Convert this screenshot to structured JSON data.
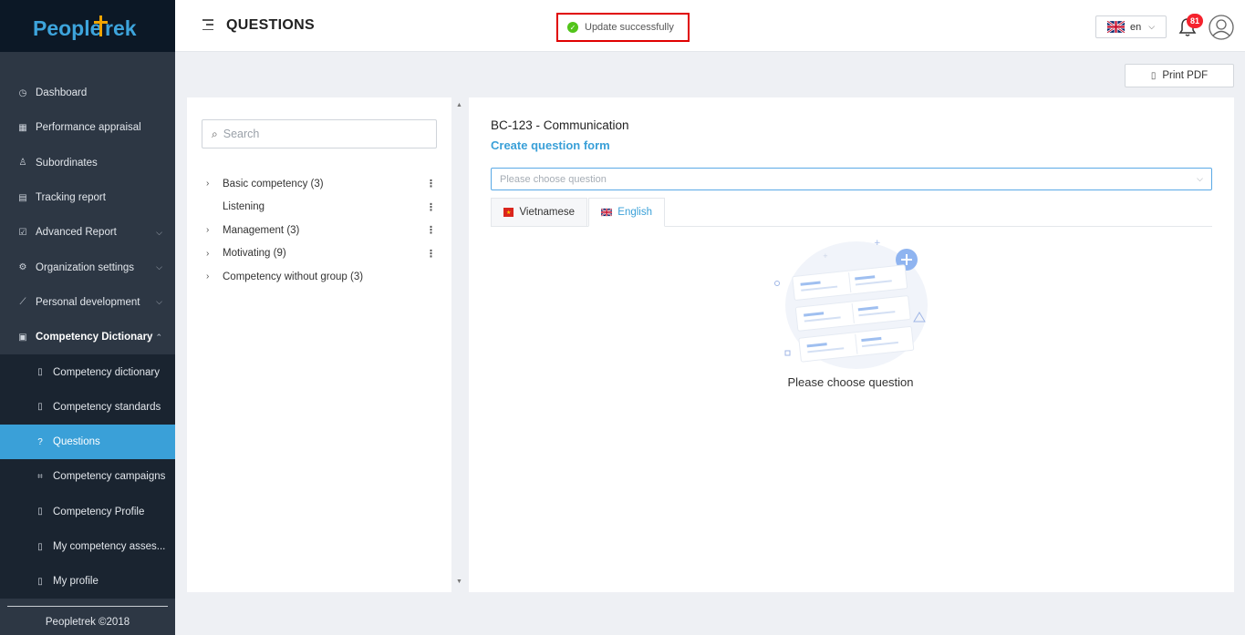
{
  "app": {
    "logo": "PeopleTrek",
    "footer": "Peopletrek ©2018"
  },
  "header": {
    "title": "QUESTIONS",
    "toast": "Update successfully",
    "language": "en",
    "notification_count": "81"
  },
  "sidebar": {
    "items": [
      {
        "label": "Dashboard",
        "icon": "dashboard-icon"
      },
      {
        "label": "Performance appraisal",
        "icon": "table-icon"
      },
      {
        "label": "Subordinates",
        "icon": "users-icon"
      },
      {
        "label": "Tracking report",
        "icon": "report-icon"
      },
      {
        "label": "Advanced Report",
        "icon": "chart-check-icon",
        "chevron": "down"
      },
      {
        "label": "Organization settings",
        "icon": "gear-icon",
        "chevron": "down"
      },
      {
        "label": "Personal development",
        "icon": "line-chart-icon",
        "chevron": "down"
      },
      {
        "label": "Competency Dictionary",
        "icon": "book-icon",
        "chevron": "up"
      }
    ],
    "subitems": [
      {
        "label": "Competency dictionary",
        "icon": "doc-search-icon"
      },
      {
        "label": "Competency standards",
        "icon": "doc-gear-icon"
      },
      {
        "label": "Questions",
        "icon": "question-icon"
      },
      {
        "label": "Competency campaigns",
        "icon": "campaign-icon"
      },
      {
        "label": "Competency Profile",
        "icon": "profile-doc-icon"
      },
      {
        "label": "My competency asses...",
        "icon": "assessment-icon"
      },
      {
        "label": "My profile",
        "icon": "my-profile-icon"
      }
    ]
  },
  "toolbar": {
    "print_label": "Print PDF"
  },
  "left_panel": {
    "search_placeholder": "Search",
    "tree": [
      {
        "label": "Basic competency",
        "count": "(3)",
        "expandable": true,
        "menu": true
      },
      {
        "label": "Listening",
        "count": "",
        "expandable": false,
        "menu": true
      },
      {
        "label": "Management",
        "count": "(3)",
        "expandable": true,
        "menu": true
      },
      {
        "label": "Motivating",
        "count": "(9)",
        "expandable": true,
        "menu": true
      },
      {
        "label": "Competency without group",
        "count": "(3)",
        "expandable": true,
        "menu": false
      }
    ]
  },
  "right_panel": {
    "title": "BC-123 - Communication",
    "create_link": "Create question form",
    "select_placeholder": "Please choose question",
    "tabs": [
      {
        "label": "Vietnamese",
        "active": false
      },
      {
        "label": "English",
        "active": true
      }
    ],
    "empty_text": "Please choose question"
  },
  "colors": {
    "accent": "#3aa0d8",
    "sidebar": "#2d3744",
    "toast_border": "#e00000",
    "success": "#52c41a",
    "badge": "#f5222d"
  }
}
